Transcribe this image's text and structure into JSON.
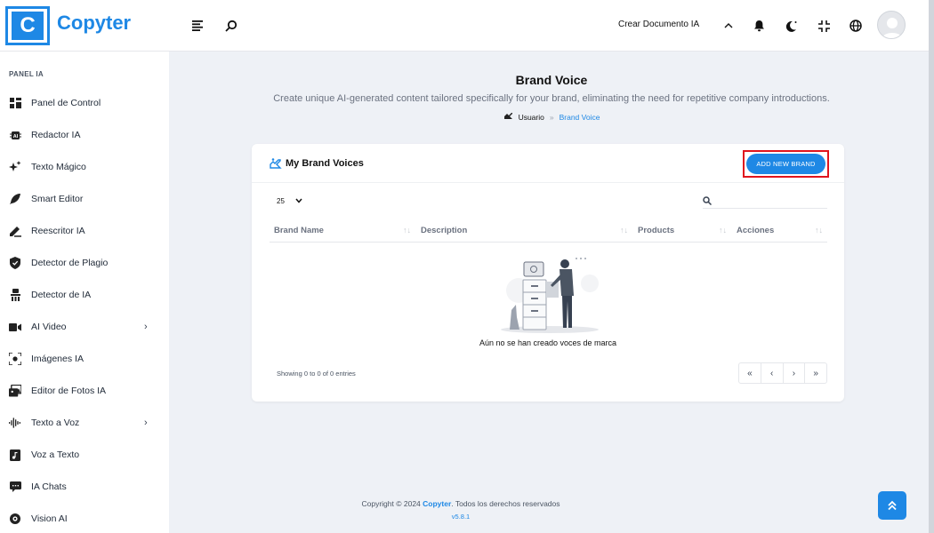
{
  "app": {
    "logo_letter": "C",
    "logo_text": "Copyter",
    "brand_color": "#1e88e5"
  },
  "header": {
    "crear_documento": "Crear Documento IA",
    "icons": [
      "menu-icon",
      "search-icon",
      "chevron-up-icon",
      "bell-icon",
      "theme-toggle-icon",
      "fullscreen-exit-icon",
      "globe-icon",
      "user-avatar"
    ]
  },
  "sidebar": {
    "section_title": "PANEL IA",
    "items": [
      {
        "label": "Panel de Control",
        "icon": "dashboard-icon",
        "chevron": false
      },
      {
        "label": "Redactor IA",
        "icon": "ai-chip-icon",
        "chevron": false
      },
      {
        "label": "Texto Mágico",
        "icon": "sparkles-icon",
        "chevron": false
      },
      {
        "label": "Smart Editor",
        "icon": "quill-icon",
        "chevron": false
      },
      {
        "label": "Reescritor IA",
        "icon": "pencil-icon",
        "chevron": false
      },
      {
        "label": "Detector de Plagio",
        "icon": "shield-icon",
        "chevron": false
      },
      {
        "label": "Detector de IA",
        "icon": "detector-icon",
        "chevron": false
      },
      {
        "label": "AI Video",
        "icon": "video-icon",
        "chevron": true
      },
      {
        "label": "Imágenes IA",
        "icon": "image-scan-icon",
        "chevron": false
      },
      {
        "label": "Editor de Fotos IA",
        "icon": "photo-edit-icon",
        "chevron": false
      },
      {
        "label": "Texto a Voz",
        "icon": "waveform-icon",
        "chevron": true
      },
      {
        "label": "Voz a Texto",
        "icon": "audio-file-icon",
        "chevron": false
      },
      {
        "label": "IA Chats",
        "icon": "chat-icon",
        "chevron": false
      },
      {
        "label": "Vision AI",
        "icon": "vision-icon",
        "chevron": false
      }
    ]
  },
  "page": {
    "title": "Brand Voice",
    "subtitle": "Create unique AI-generated content tailored specifically for your brand, eliminating the need for repetitive company introductions.",
    "breadcrumb": {
      "home": "Usuario",
      "separator": "»",
      "current": "Brand Voice"
    }
  },
  "card": {
    "title": "My Brand Voices",
    "add_button": "ADD NEW BRAND",
    "page_length": "25",
    "columns": [
      "Brand Name",
      "Description",
      "Products",
      "Acciones"
    ],
    "empty_message": "Aún no se han creado voces de marca",
    "showing": "Showing 0 to 0 of 0 entries",
    "pager": [
      "«",
      "‹",
      "›",
      "»"
    ]
  },
  "footer": {
    "copyright_prefix": "Copyright © 2024",
    "brand": "Copyter",
    "copyright_suffix": ". Todos los derechos reservados",
    "version": "v5.8.1"
  },
  "colors": {
    "accent": "#1e88e5",
    "highlight_border": "#e0141d",
    "background": "#eef1f6"
  }
}
